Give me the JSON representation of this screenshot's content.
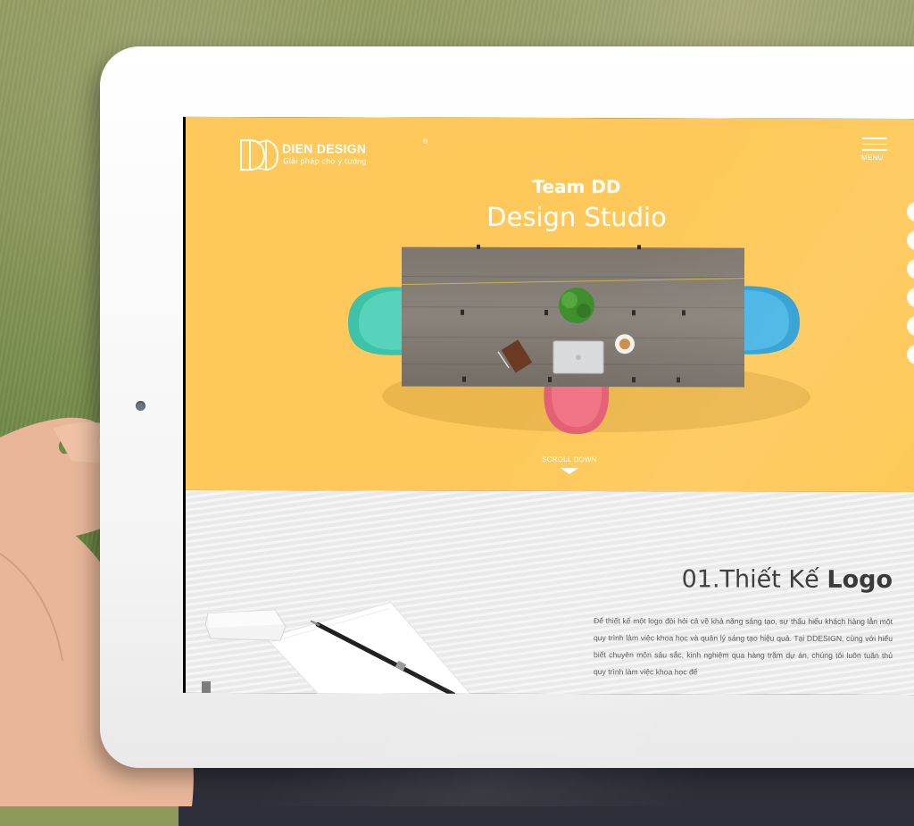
{
  "brand": {
    "name": "DIEN DESIGN",
    "registered": "®",
    "tagline": "Giải pháp cho ý tưởng"
  },
  "menu": {
    "label": "MENU"
  },
  "hero": {
    "title": "Team DD",
    "subtitle": "Design Studio",
    "background_color": "#fec95a",
    "scroll_label": "SCROLL DOWN"
  },
  "section": {
    "number": "01.Thiết Kế",
    "title_bold": "Logo",
    "paragraph": "Để thiết kế một logo đòi hỏi cả về khả năng sáng tạo, sự thấu hiểu khách hàng lẫn một quy trình làm việc khoa học và quản lý sáng tạo hiệu quả. Tại DDESIGN, cùng với hiểu biết chuyên môn sâu sắc, kinh nghiệm qua hàng trăm dự án, chúng tôi luôn tuân thủ quy trình làm việc khoa học để"
  },
  "side_nav": {
    "count": 6
  },
  "icons": [
    "logo-mark-icon",
    "menu-icon",
    "scroll-down-arrow-icon"
  ]
}
